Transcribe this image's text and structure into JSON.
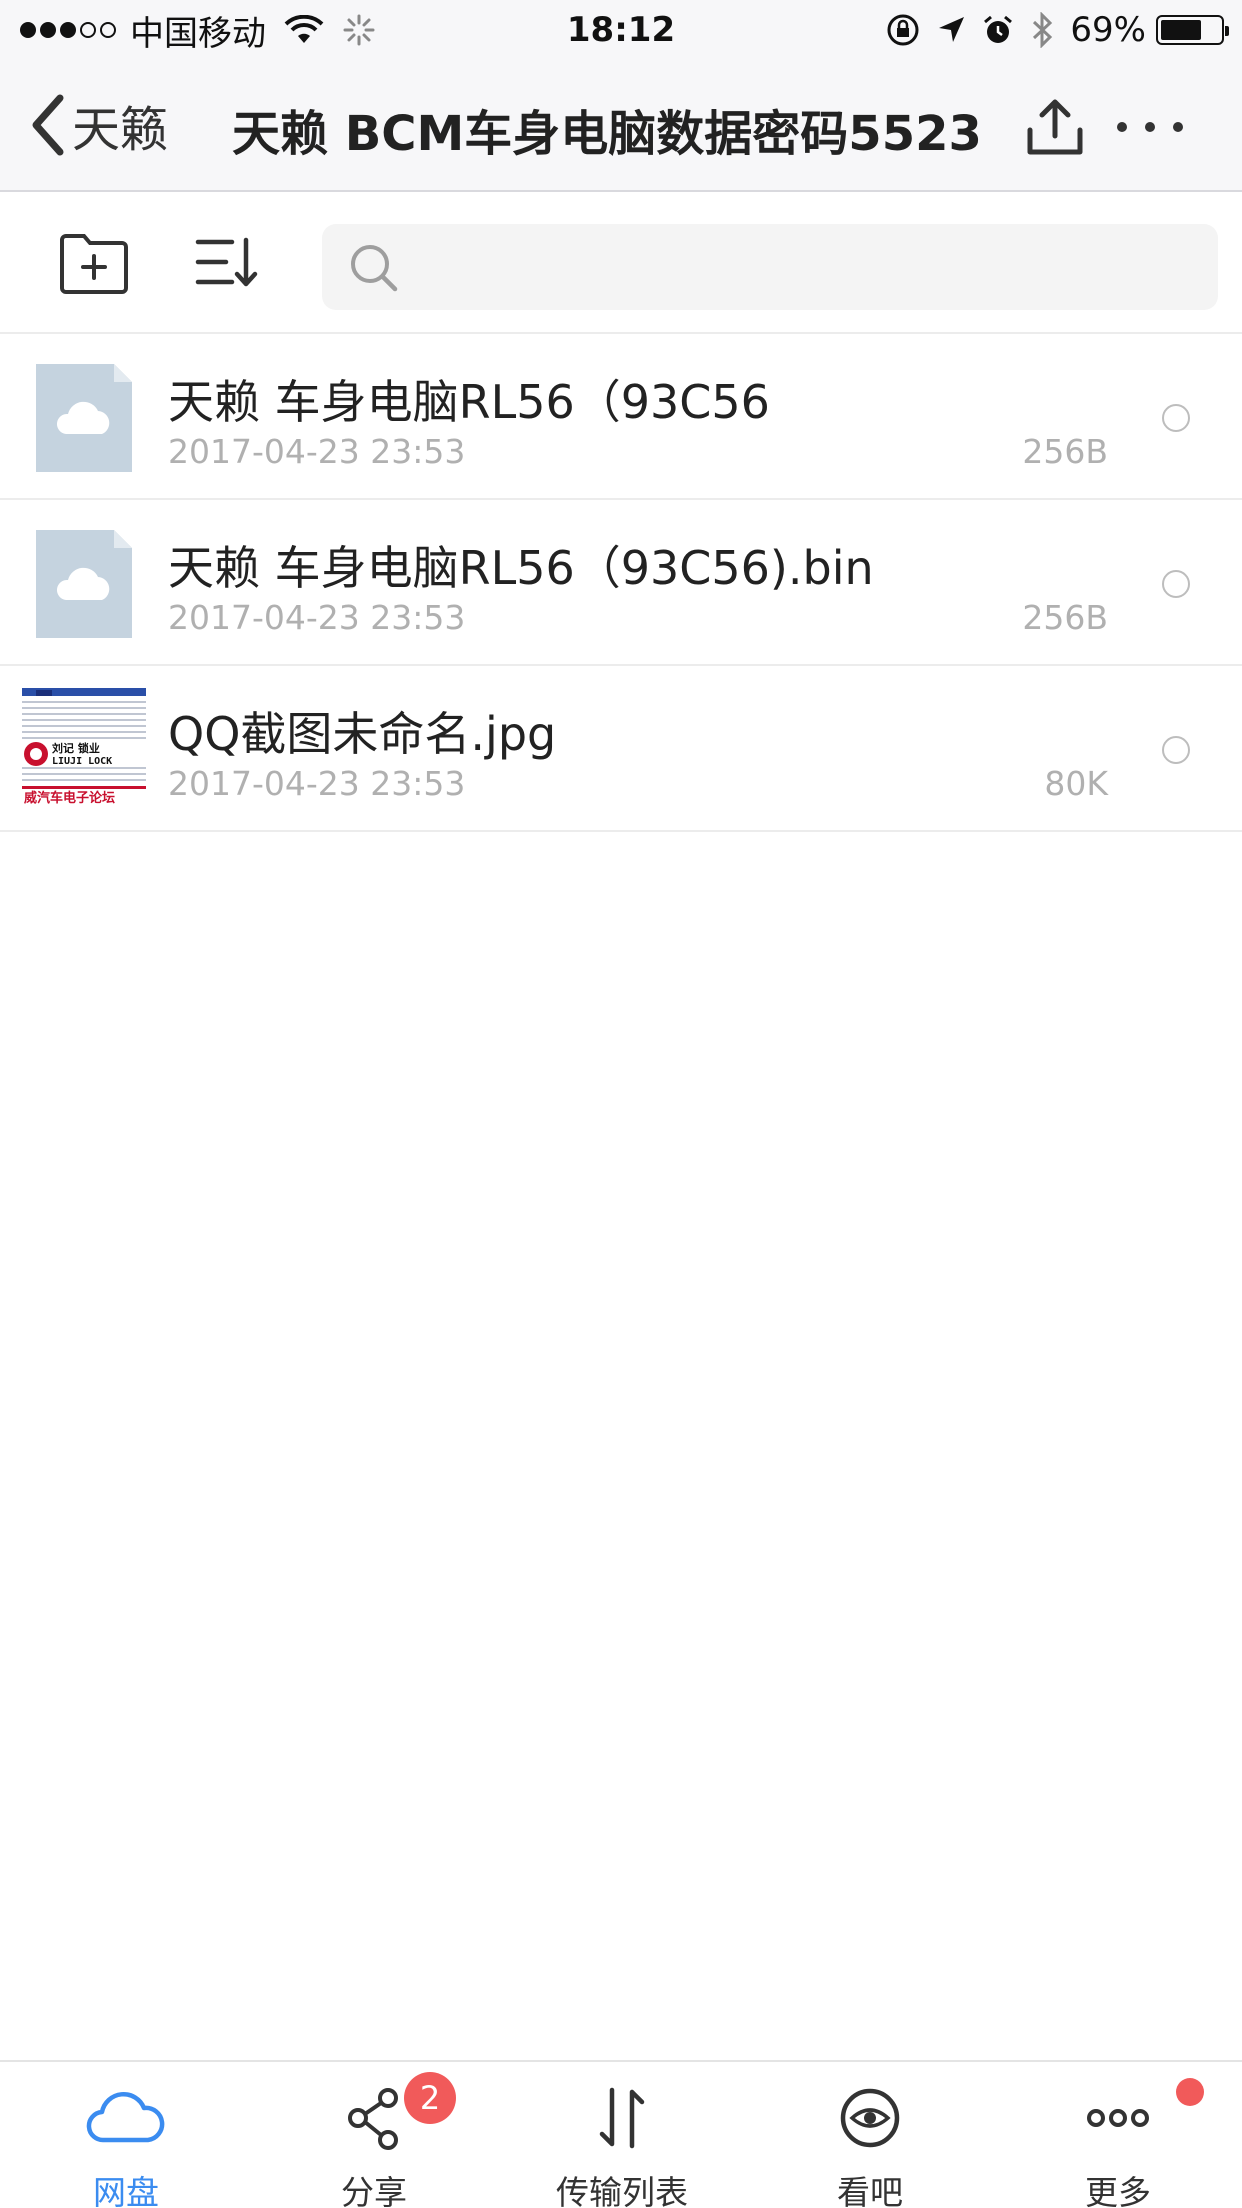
{
  "status_bar": {
    "signal_full": 3,
    "signal_empty": 2,
    "carrier": "中国移动",
    "time": "18:12",
    "battery_percent": "69%",
    "battery_level": 0.69,
    "icons": [
      "wifi-icon",
      "loading-spinner-icon",
      "rotation-lock-icon",
      "location-arrow-icon",
      "alarm-icon",
      "bluetooth-icon",
      "battery-icon"
    ]
  },
  "nav": {
    "back_label": "天籁",
    "title": "天赖 BCM车身电脑数据密码5523",
    "icons": [
      "back-chevron-icon",
      "upload-icon",
      "more-dots-icon"
    ]
  },
  "toolbar": {
    "search_placeholder": "",
    "icons": [
      "new-folder-icon",
      "sort-icon",
      "search-icon"
    ]
  },
  "files": [
    {
      "name": "天赖 车身电脑RL56（93C56",
      "date": "2017-04-23 23:53",
      "size": "256B",
      "thumb": "cloud-file-icon"
    },
    {
      "name": "天赖 车身电脑RL56（93C56).bin",
      "date": "2017-04-23 23:53",
      "size": "256B",
      "thumb": "cloud-file-icon"
    },
    {
      "name": "QQ截图未命名.jpg",
      "date": "2017-04-23 23:53",
      "size": "80K",
      "thumb": "image-thumbnail"
    }
  ],
  "thumbnail_text": {
    "brand": "刘记 锁业",
    "brand_latin": "LIUJI LOCK",
    "footer": "威汽车电子论坛"
  },
  "tabs": [
    {
      "label": "网盘",
      "icon": "cloud-icon",
      "active": true
    },
    {
      "label": "分享",
      "icon": "share-icon",
      "badge": "2"
    },
    {
      "label": "传输列表",
      "icon": "transfer-icon"
    },
    {
      "label": "看吧",
      "icon": "eye-icon"
    },
    {
      "label": "更多",
      "icon": "more-icon",
      "dot": true
    }
  ],
  "colors": {
    "accent": "#3b8cf0",
    "badge": "#f15a5a",
    "file_thumb_bg": "#c5d3df",
    "bar_bg": "#f7f7f9"
  }
}
